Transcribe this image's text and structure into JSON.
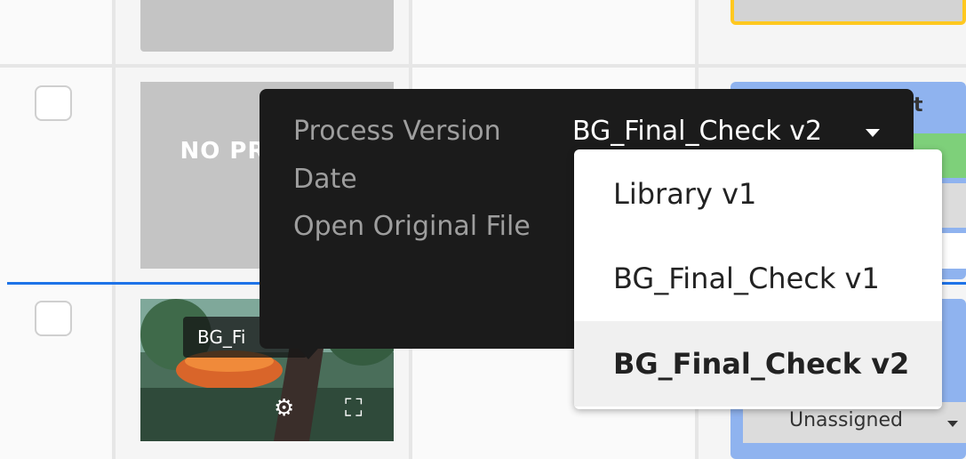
{
  "rows": [
    {
      "preview_text": "NO PREVIEW"
    },
    {
      "thumbnail_label": "BG_Fi"
    }
  ],
  "popover": {
    "fields": [
      {
        "label": "Process Version",
        "value": "BG_Final_Check v2"
      },
      {
        "label": "Date"
      },
      {
        "label": "Open Original File"
      }
    ]
  },
  "version_menu": {
    "options": [
      "Library v1",
      "BG_Final_Check v1",
      "BG_Final_Check v2"
    ],
    "selected": "BG_Final_Check v2"
  },
  "right_column": {
    "header_fragment": "t",
    "assignee": "Unassigned"
  },
  "colors": {
    "popover_bg": "#1b1b1b",
    "selection_line": "#1e73e8",
    "card_blue": "#8fb3ef",
    "card_green": "#7ed07a",
    "card_yellow_border": "#ffc820"
  },
  "icons": [
    "gears-icon",
    "fullscreen-icon",
    "checkbox",
    "chevron-down-icon"
  ]
}
